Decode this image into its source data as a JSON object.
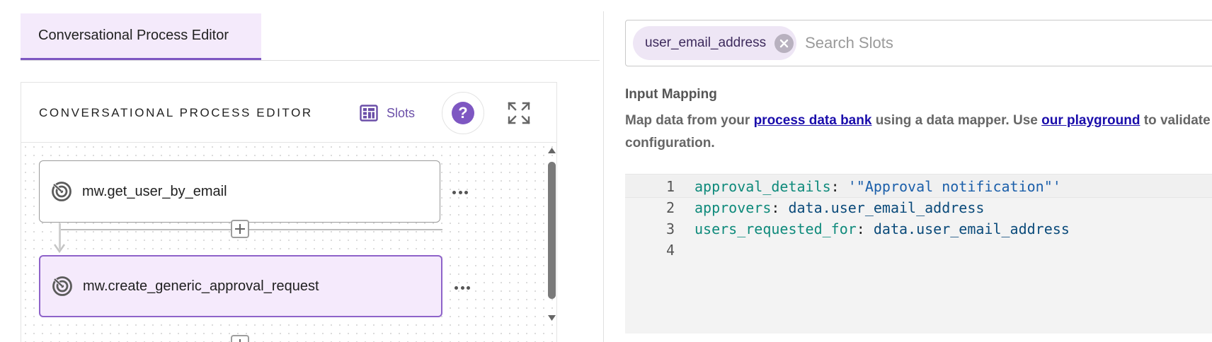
{
  "left_panel": {
    "tab_label": "Conversational Process Editor",
    "editor": {
      "title": "CONVERSATIONAL PROCESS EDITOR",
      "slots_label": "Slots",
      "help_glyph": "?",
      "nodes": [
        {
          "label": "mw.get_user_by_email",
          "selected": false
        },
        {
          "label": "mw.create_generic_approval_request",
          "selected": true
        }
      ]
    }
  },
  "right_panel": {
    "search": {
      "chip_label": "user_email_address",
      "placeholder": "Search Slots"
    },
    "input_mapping": {
      "title": "Input Mapping",
      "desc_part1": "Map data from your ",
      "link1": "process data bank",
      "desc_part2": " using a data mapper. Use ",
      "link2": "our playground",
      "desc_part3": " to validate your configuration."
    },
    "code_lines": [
      {
        "num": "1",
        "key": "approval_details",
        "sep": ": ",
        "value": "'\"Approval notification\"'",
        "value_type": "string"
      },
      {
        "num": "2",
        "key": "approvers",
        "sep": ": ",
        "value": "data.user_email_address",
        "value_type": "ref"
      },
      {
        "num": "3",
        "key": "users_requested_for",
        "sep": ": ",
        "value": "data.user_email_address",
        "value_type": "ref"
      },
      {
        "num": "4",
        "key": "",
        "sep": "",
        "value": "",
        "value_type": ""
      }
    ]
  },
  "colors": {
    "accent": "#7e57c2",
    "tab_bg": "#f4eafb",
    "selected_node_bg": "#f5eafc",
    "link": "#1a0dab"
  },
  "icons": {
    "slots": "slots-grid-icon",
    "help": "help-icon",
    "fullscreen": "expand-icon",
    "node": "action-node-icon",
    "more": "more-horizontal-icon",
    "add": "add-step-icon",
    "chip_close": "close-icon"
  }
}
